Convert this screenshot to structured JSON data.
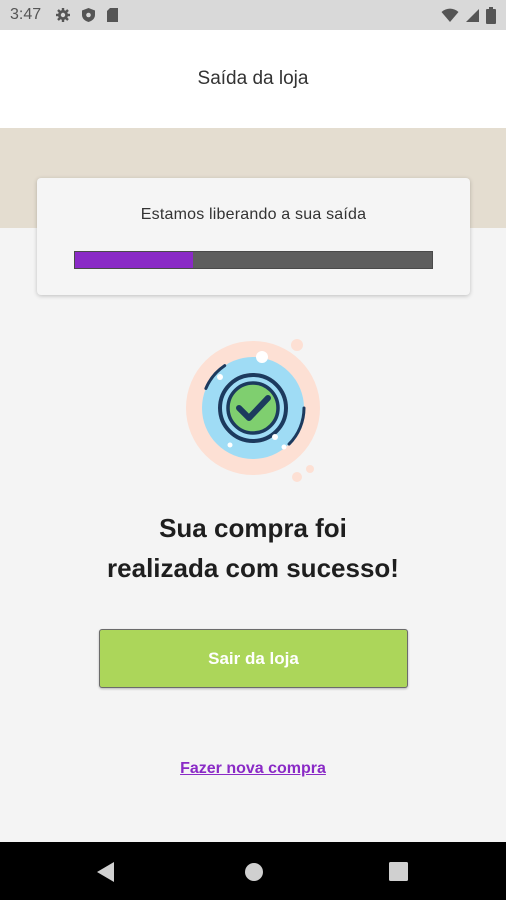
{
  "status_bar": {
    "time": "3:47",
    "left_icons": [
      "gear-icon",
      "shield-icon",
      "sd-card-icon"
    ],
    "right_icons": [
      "wifi-icon",
      "signal-icon",
      "battery-icon"
    ]
  },
  "header": {
    "title": "Saída da loja"
  },
  "progress": {
    "message": "Estamos liberando a sua saída",
    "percent": 33,
    "fill_color": "#8a2ac6",
    "track_color": "#5e5e5e"
  },
  "success": {
    "icon": "check-circle-icon",
    "line1": "Sua compra foi",
    "line2": "realizada com sucesso!"
  },
  "actions": {
    "exit_label": "Sair da loja",
    "exit_color": "#acd65a",
    "new_purchase_label": "Fazer nova compra",
    "link_color": "#8a2ac6"
  },
  "nav_bar": {
    "buttons": [
      "back-icon",
      "home-icon",
      "recents-icon"
    ]
  }
}
